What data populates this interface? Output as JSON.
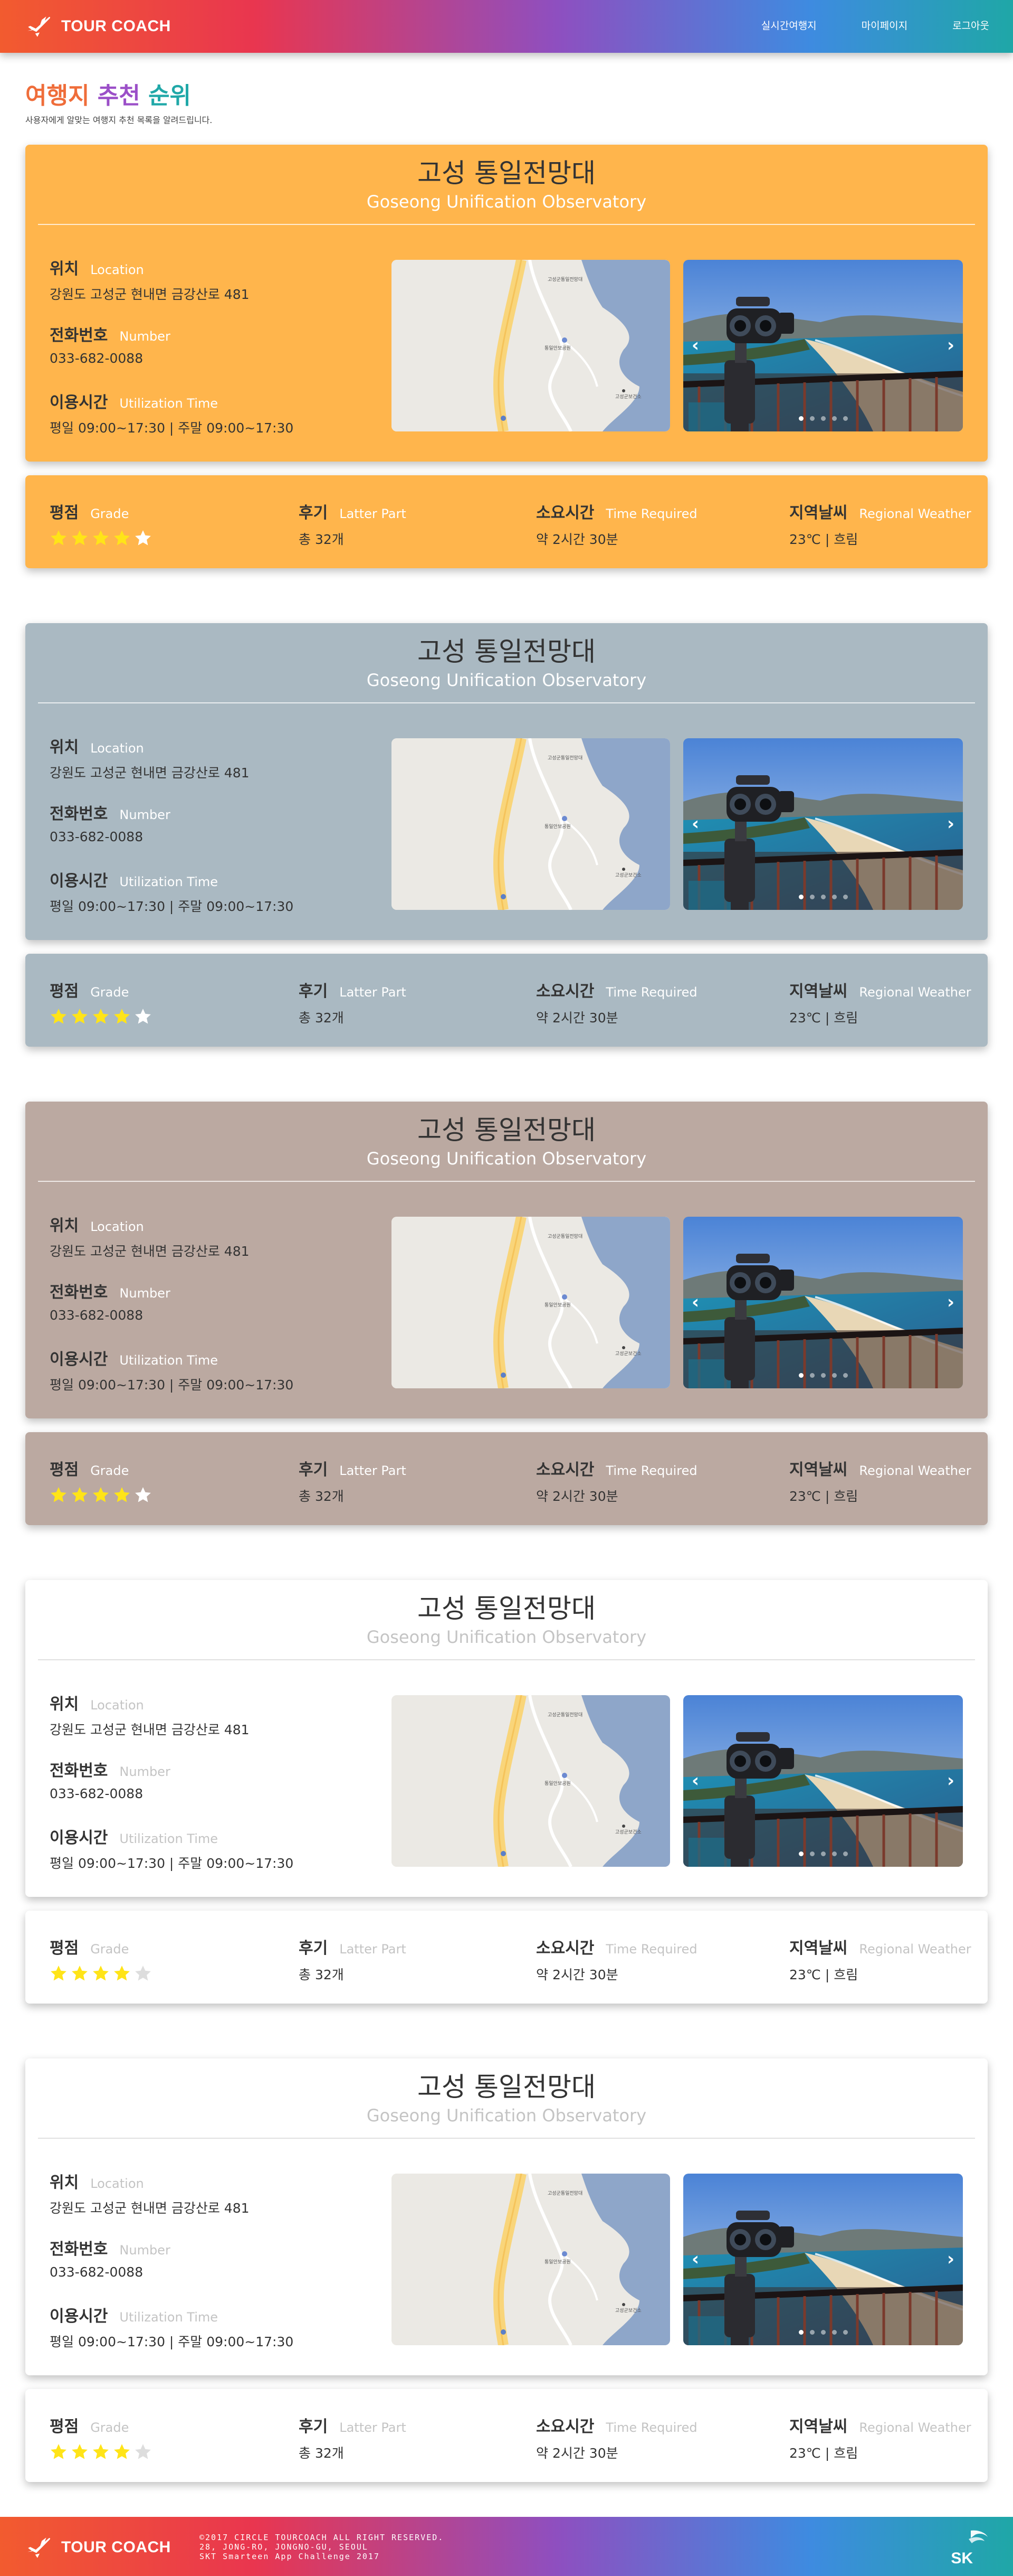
{
  "header": {
    "brand": "TOUR COACH",
    "nav": [
      "실시간여행지",
      "마이페이지",
      "로그아웃"
    ]
  },
  "page": {
    "title": {
      "part1": "여행지",
      "part2": "추천",
      "part3": "순위"
    },
    "subtitle": "사용자에게 알맞는 여행지 추천 목록을 알려드립니다."
  },
  "labels": {
    "location": {
      "ko": "위치",
      "en": "Location"
    },
    "phone": {
      "ko": "전화번호",
      "en": "Number"
    },
    "hours": {
      "ko": "이용시간",
      "en": "Utilization Time"
    },
    "grade": {
      "ko": "평점",
      "en": "Grade"
    },
    "reviews": {
      "ko": "후기",
      "en": "Latter Part"
    },
    "duration": {
      "ko": "소요시간",
      "en": "Time Required"
    },
    "weather": {
      "ko": "지역날씨",
      "en": "Regional Weather"
    }
  },
  "recommendations": [
    {
      "name_ko": "고성 통일전망대",
      "name_en": "Goseong Unification Observatory",
      "location": "강원도 고성군 현내면 금강산로 481",
      "phone": "033-682-0088",
      "hours": "평일 09:00~17:30  |  주말 09:00~17:30",
      "rating": 4,
      "reviews": "총 32개",
      "duration": "약 2시간 30분",
      "weather": "23℃  |  흐림",
      "theme": "orange"
    },
    {
      "name_ko": "고성 통일전망대",
      "name_en": "Goseong Unification Observatory",
      "location": "강원도 고성군 현내면 금강산로 481",
      "phone": "033-682-0088",
      "hours": "평일 09:00~17:30  |  주말 09:00~17:30",
      "rating": 4,
      "reviews": "총 32개",
      "duration": "약 2시간 30분",
      "weather": "23℃  |  흐림",
      "theme": "steel"
    },
    {
      "name_ko": "고성 통일전망대",
      "name_en": "Goseong Unification Observatory",
      "location": "강원도 고성군 현내면 금강산로 481",
      "phone": "033-682-0088",
      "hours": "평일 09:00~17:30  |  주말 09:00~17:30",
      "rating": 4,
      "reviews": "총 32개",
      "duration": "약 2시간 30분",
      "weather": "23℃  |  흐림",
      "theme": "taupe"
    },
    {
      "name_ko": "고성 통일전망대",
      "name_en": "Goseong Unification Observatory",
      "location": "강원도 고성군 현내면 금강산로 481",
      "phone": "033-682-0088",
      "hours": "평일 09:00~17:30  |  주말 09:00~17:30",
      "rating": 4,
      "reviews": "총 32개",
      "duration": "약 2시간 30분",
      "weather": "23℃  |  흐림",
      "theme": "white"
    },
    {
      "name_ko": "고성 통일전망대",
      "name_en": "Goseong Unification Observatory",
      "location": "강원도 고성군 현내면 금강산로 481",
      "phone": "033-682-0088",
      "hours": "평일 09:00~17:30  |  주말 09:00~17:30",
      "rating": 4,
      "reviews": "총 32개",
      "duration": "약 2시간 30분",
      "weather": "23℃  |  흐림",
      "theme": "white"
    }
  ],
  "map_labels": [
    "고성군통일전망대",
    "통일안보공원",
    "고성군보건소"
  ],
  "theme_colors": {
    "orange": "#ffb54c",
    "steel": "#aab9c2",
    "taupe": "#bba9a1",
    "white": "#ffffff",
    "star_on": "#ffe418",
    "star_off": "#ffffff",
    "star_off_white": "#dddddd"
  },
  "icons": {
    "brand": "airplane-icon",
    "prev": "chevron-left-icon",
    "next": "chevron-right-icon",
    "star": "star-icon",
    "sk": "sk-logo-icon"
  },
  "footer": {
    "brand": "TOUR COACH",
    "lines": [
      "©2017 CIRCLE TOURCOACH ALL RIGHT RESERVED.",
      "28, JONG-RO, JONGNO-GU, SEOUL",
      "SKT Smarteen App Challenge 2017"
    ],
    "sk_logo": "SK"
  }
}
